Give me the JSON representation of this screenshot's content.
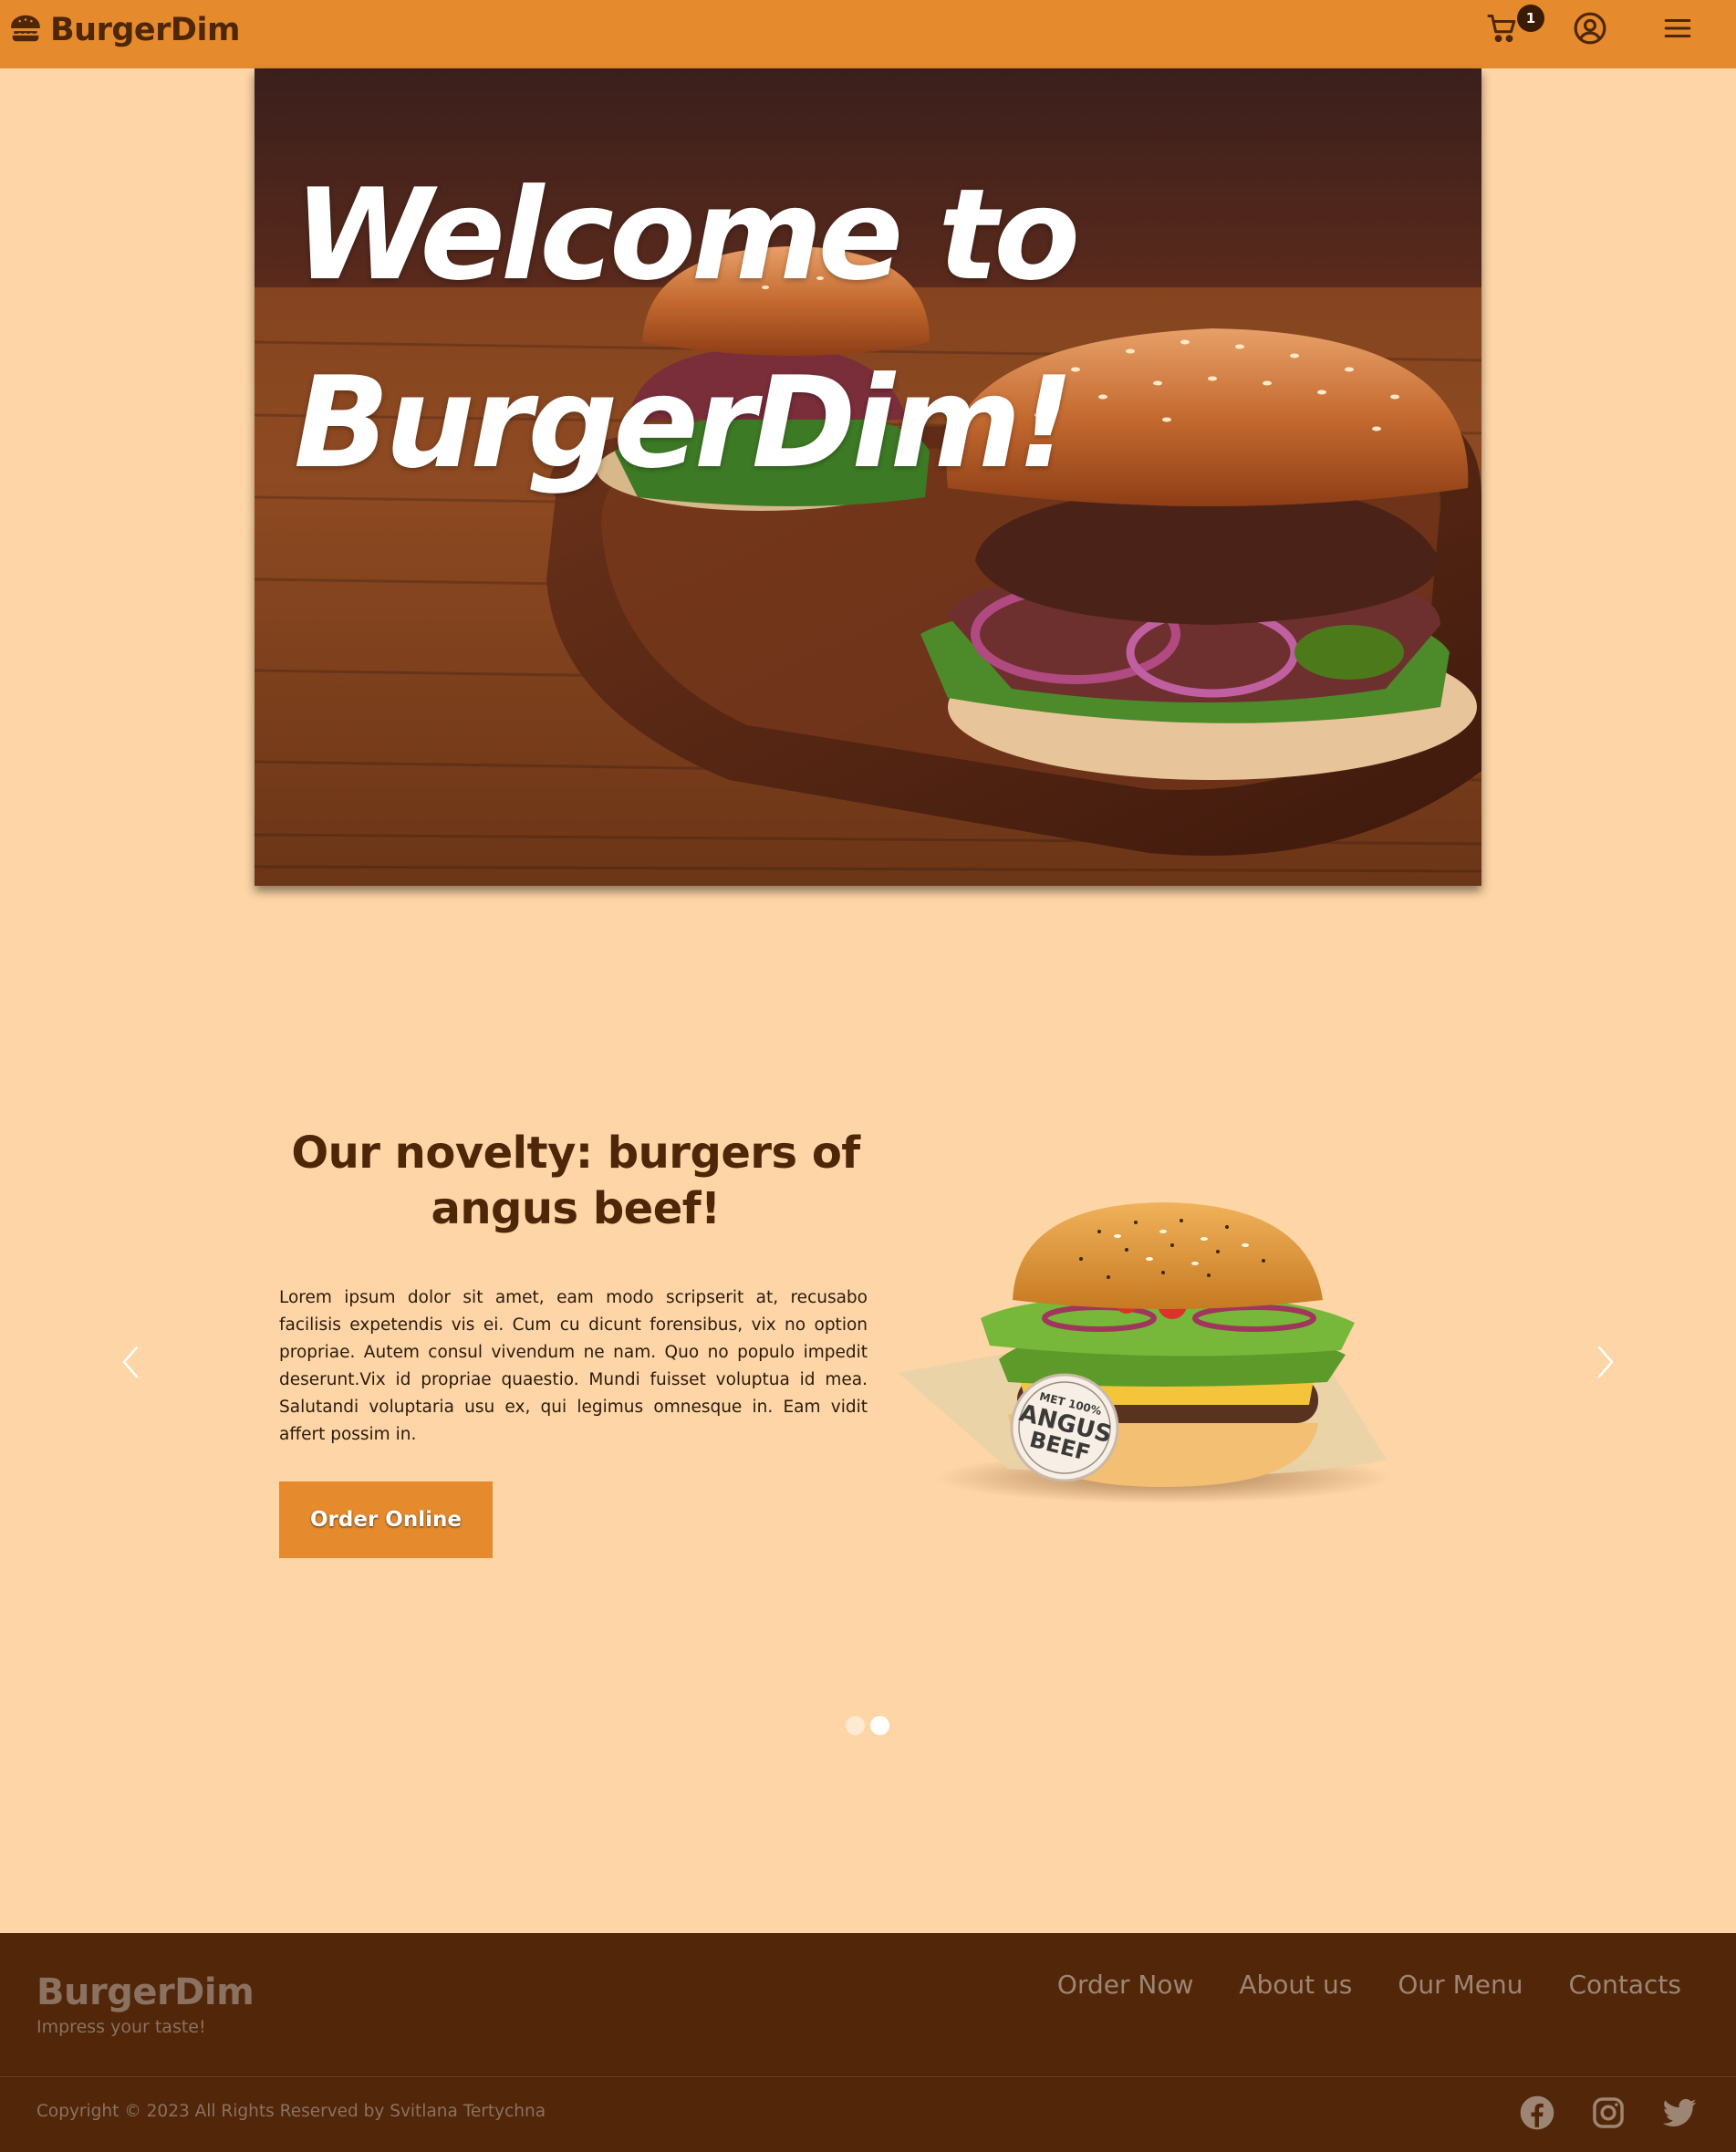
{
  "header": {
    "brand": "BurgerDim",
    "cart_count": "1",
    "icons": [
      "burger-icon",
      "cart-icon",
      "account-icon",
      "menu-icon"
    ]
  },
  "hero": {
    "title_line1": "Welcome to",
    "title_line2": "BurgerDim!"
  },
  "slide": {
    "title": "Our novelty: burgers of angus beef!",
    "text": "Lorem ipsum dolor sit amet, eam modo scripserit at, recusabo facilisis expetendis vis ei. Cum cu dicunt forensibus, vix no option propriae. Autem consul vivendum ne nam. Quo no populo impedit deserunt.Vix id propriae quaestio. Mundi fuisset voluptua id mea. Salutandi voluptaria usu ex, qui legimus omnesque in. Eam vidit affert possim in.",
    "button": "Order Online",
    "badge_line1": "MET 100%",
    "badge_line2": "ANGUS",
    "badge_line3": "BEEF",
    "active_slide": 2,
    "slide_count": 2
  },
  "footer": {
    "brand": "BurgerDim",
    "tagline": "Impress your taste!",
    "nav": [
      "Order Now",
      "About us",
      "Our Menu",
      "Contacts"
    ],
    "copyright": "Copyright © 2023 All Rights Reserved by Svitlana Tertychna",
    "social": [
      "facebook-icon",
      "instagram-icon",
      "twitter-icon"
    ]
  },
  "colors": {
    "header_bg": "#e58a2d",
    "page_bg": "#fdd5a6",
    "footer_bg": "#512609",
    "text_dark": "#4e2608"
  }
}
